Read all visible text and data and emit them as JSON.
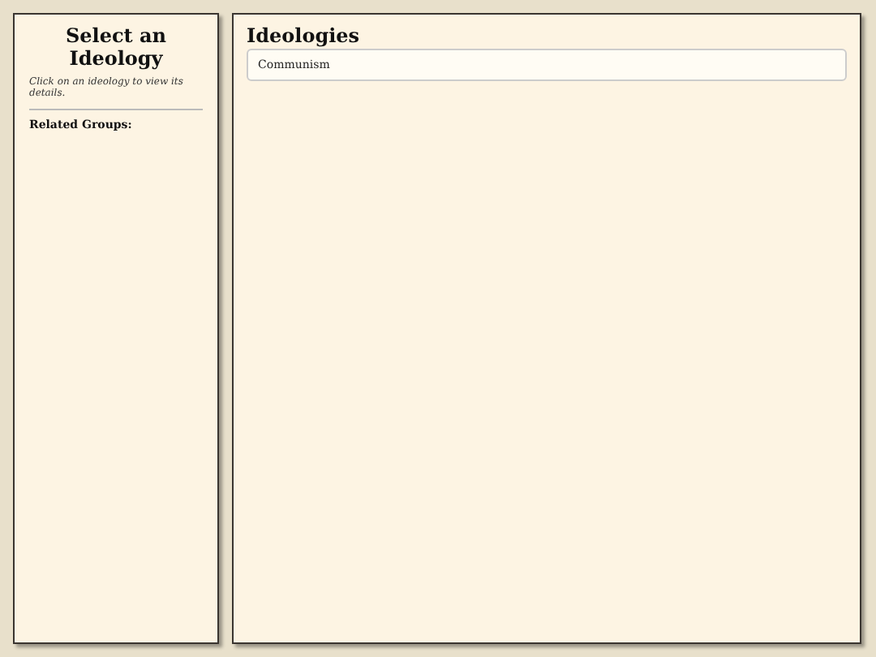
{
  "sidebar": {
    "title": "Select an Ideology",
    "hint": "Click on an ideology to view its details.",
    "related_heading": "Related Groups:"
  },
  "main": {
    "title": "Ideologies",
    "items": [
      {
        "label": "Communism"
      }
    ]
  }
}
